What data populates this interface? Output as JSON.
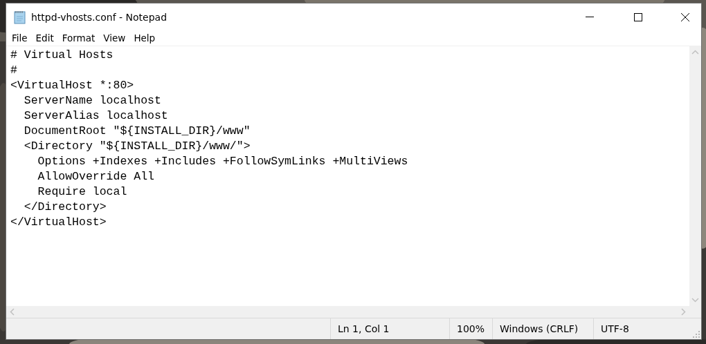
{
  "window": {
    "title": "httpd-vhosts.conf - Notepad"
  },
  "menu": [
    "File",
    "Edit",
    "Format",
    "View",
    "Help"
  ],
  "editor": {
    "lines": [
      "# Virtual Hosts",
      "#",
      "<VirtualHost *:80>",
      "  ServerName localhost",
      "  ServerAlias localhost",
      "  DocumentRoot \"${INSTALL_DIR}/www\"",
      "  <Directory \"${INSTALL_DIR}/www/\">",
      "    Options +Indexes +Includes +FollowSymLinks +MultiViews",
      "    AllowOverride All",
      "    Require local",
      "  </Directory>",
      "</VirtualHost>"
    ]
  },
  "status_bar": {
    "position": "Ln 1, Col 1",
    "zoom": "100%",
    "line_endings": "Windows (CRLF)",
    "encoding": "UTF-8"
  }
}
